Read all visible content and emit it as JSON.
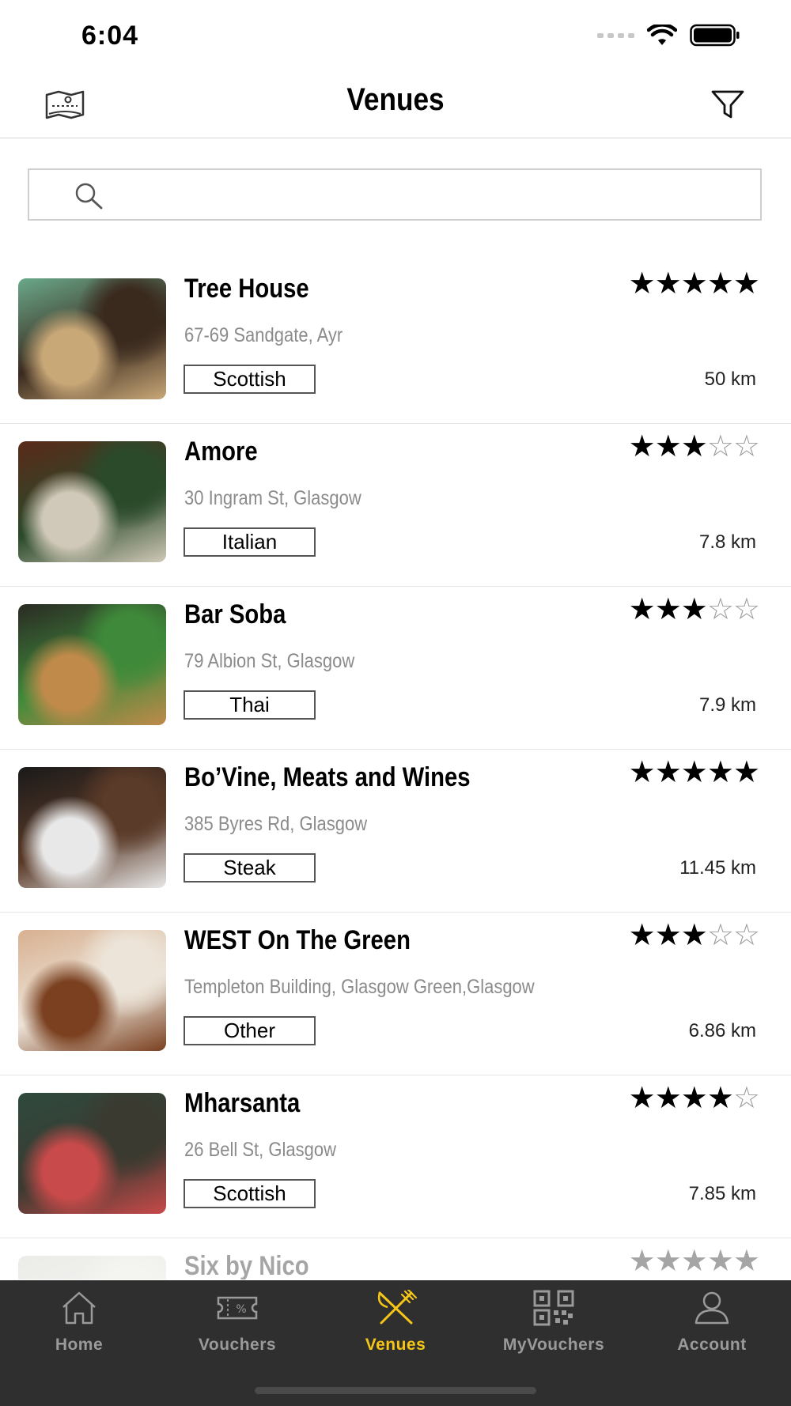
{
  "status_bar": {
    "time": "6:04"
  },
  "nav": {
    "title": "Venues",
    "left_icon": "map-book-icon",
    "right_icon": "filter-icon"
  },
  "search": {
    "placeholder": ""
  },
  "venues": [
    {
      "name": "Tree House",
      "address": "67-69 Sandgate, Ayr",
      "cuisine": "Scottish",
      "distance": "50 km",
      "rating": 5,
      "photo_colors": [
        "#6aa88a",
        "#c9a878",
        "#3a2a1e"
      ]
    },
    {
      "name": "Amore",
      "address": "30 Ingram St, Glasgow",
      "cuisine": "Italian",
      "distance": "7.8 km",
      "rating": 3,
      "photo_colors": [
        "#5a2a1a",
        "#d0c8b8",
        "#2a4a2a"
      ]
    },
    {
      "name": "Bar Soba",
      "address": "79 Albion St, Glasgow",
      "cuisine": "Thai",
      "distance": "7.9 km",
      "rating": 3,
      "photo_colors": [
        "#2a2a24",
        "#c08a4a",
        "#3f8a3a"
      ]
    },
    {
      "name": "Bo’Vine, Meats and Wines",
      "address": "385 Byres Rd, Glasgow",
      "cuisine": "Steak",
      "distance": "11.45 km",
      "rating": 5,
      "photo_colors": [
        "#1a1a1a",
        "#e8e8e8",
        "#5a3a28"
      ]
    },
    {
      "name": "WEST On The Green",
      "address": "Templeton Building, Glasgow Green,Glasgow",
      "cuisine": "Other",
      "distance": "6.86 km",
      "rating": 3,
      "photo_colors": [
        "#d8b090",
        "#7a4020",
        "#ece4d8"
      ]
    },
    {
      "name": "Mharsanta",
      "address": "26 Bell St, Glasgow",
      "cuisine": "Scottish",
      "distance": "7.85 km",
      "rating": 4,
      "photo_colors": [
        "#2f4a3e",
        "#c84a4a",
        "#3a3a30"
      ]
    },
    {
      "name": "Six by Nico",
      "address": "",
      "cuisine": "",
      "distance": "",
      "rating": 5,
      "photo_colors": [
        "#c8c8c0",
        "#a0a098",
        "#e0e0d8"
      ]
    }
  ],
  "tabs": [
    {
      "label": "Home",
      "icon": "home-icon",
      "active": false
    },
    {
      "label": "Vouchers",
      "icon": "voucher-icon",
      "active": false
    },
    {
      "label": "Venues",
      "icon": "fork-knife-icon",
      "active": true
    },
    {
      "label": "MyVouchers",
      "icon": "qr-code-icon",
      "active": false
    },
    {
      "label": "Account",
      "icon": "user-icon",
      "active": false
    }
  ],
  "colors": {
    "tab_bar_bg": "#2f2f2f",
    "tab_active": "#f5c518",
    "tab_inactive": "#9a9a9a",
    "address_gray": "#8b8b8b"
  }
}
